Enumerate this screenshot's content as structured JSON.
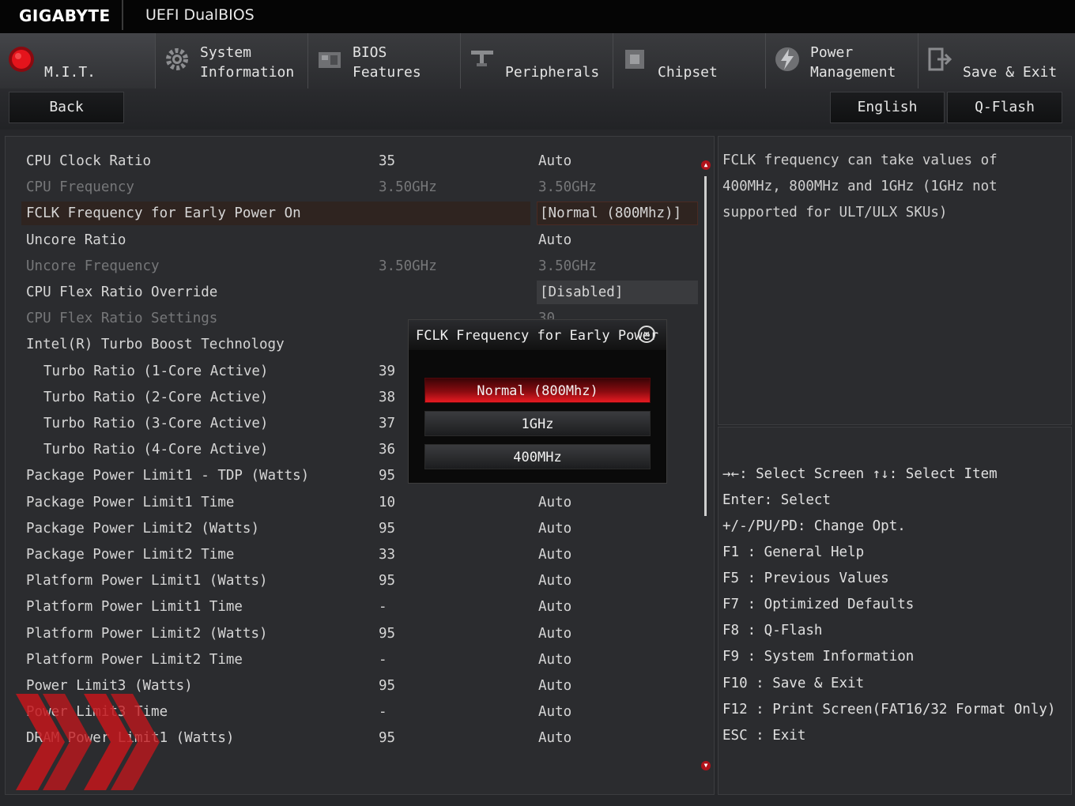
{
  "header": {
    "brand": "GIGABYTE",
    "product": "UEFI DualBIOS"
  },
  "tabs": [
    {
      "line1": "",
      "line2": "M.I.T.",
      "icon": "mit-red-orb-icon",
      "active": true
    },
    {
      "line1": "System",
      "line2": "Information",
      "icon": "gear-icon"
    },
    {
      "line1": "BIOS",
      "line2": "Features",
      "icon": "bios-chip-icon"
    },
    {
      "line1": "",
      "line2": "Peripherals",
      "icon": "peripherals-icon"
    },
    {
      "line1": "",
      "line2": "Chipset",
      "icon": "chipset-icon"
    },
    {
      "line1": "Power",
      "line2": "Management",
      "icon": "power-lightning-icon"
    },
    {
      "line1": "",
      "line2": "Save & Exit",
      "icon": "exit-door-icon"
    }
  ],
  "buttons": {
    "back": "Back",
    "language": "English",
    "qflash": "Q-Flash"
  },
  "settings": [
    {
      "name": "CPU Clock Ratio",
      "value": "35",
      "setting": "Auto"
    },
    {
      "name": "CPU Frequency",
      "value": "3.50GHz",
      "setting": "3.50GHz",
      "dim": true
    },
    {
      "name": "FCLK Frequency for Early Power On",
      "value": "",
      "setting": "[Normal (800Mhz)]",
      "selected": true
    },
    {
      "name": "Uncore Ratio",
      "value": "",
      "setting": "Auto"
    },
    {
      "name": "Uncore Frequency",
      "value": "3.50GHz",
      "setting": "3.50GHz",
      "dim": true
    },
    {
      "name": "CPU Flex Ratio Override",
      "value": "",
      "setting": "[Disabled]",
      "box": true
    },
    {
      "name": "CPU Flex Ratio Settings",
      "value": "",
      "setting": "30",
      "dim": true
    },
    {
      "name": "Intel(R) Turbo Boost Technology",
      "value": "",
      "setting": ""
    },
    {
      "name": "Turbo Ratio (1-Core Active)",
      "value": "39",
      "setting": "",
      "indent": true
    },
    {
      "name": "Turbo Ratio (2-Core Active)",
      "value": "38",
      "setting": "",
      "indent": true
    },
    {
      "name": "Turbo Ratio (3-Core Active)",
      "value": "37",
      "setting": "",
      "indent": true
    },
    {
      "name": "Turbo Ratio (4-Core Active)",
      "value": "36",
      "setting": "",
      "indent": true
    },
    {
      "name": "Package Power Limit1 - TDP (Watts)",
      "value": "95",
      "setting": ""
    },
    {
      "name": "Package Power Limit1 Time",
      "value": "10",
      "setting": "Auto"
    },
    {
      "name": "Package Power Limit2 (Watts)",
      "value": "95",
      "setting": "Auto"
    },
    {
      "name": "Package Power Limit2 Time",
      "value": "33",
      "setting": "Auto"
    },
    {
      "name": "Platform Power Limit1 (Watts)",
      "value": "95",
      "setting": "Auto"
    },
    {
      "name": "Platform Power Limit1 Time",
      "value": "-",
      "setting": "Auto"
    },
    {
      "name": "Platform Power Limit2 (Watts)",
      "value": "95",
      "setting": "Auto"
    },
    {
      "name": "Platform Power Limit2 Time",
      "value": "-",
      "setting": "Auto"
    },
    {
      "name": "Power Limit3 (Watts)",
      "value": "95",
      "setting": "Auto"
    },
    {
      "name": "Power Limit3 Time",
      "value": "-",
      "setting": "Auto"
    },
    {
      "name": "DRAM Power Limit1 (Watts)",
      "value": "95",
      "setting": "Auto"
    }
  ],
  "help_text": [
    "FCLK frequency can take values of",
    "400MHz, 800MHz  and 1GHz (1GHz not",
    "supported for ULT/ULX SKUs)"
  ],
  "key_help": [
    "→←: Select Screen  ↑↓: Select Item",
    "Enter: Select",
    "+/-/PU/PD: Change Opt.",
    "F1  : General Help",
    "F5  : Previous Values",
    "F7  : Optimized Defaults",
    "F8  : Q-Flash",
    "F9  : System Information",
    "F10 : Save & Exit",
    "F12 : Print Screen(FAT16/32 Format Only)",
    "ESC : Exit"
  ],
  "popup": {
    "title": "FCLK Frequency for Early Power",
    "options": [
      "Normal (800Mhz)",
      "1GHz",
      "400MHz"
    ],
    "selected_index": 0
  },
  "colors": {
    "accent_red": "#e81b22",
    "background": "#26272a"
  }
}
